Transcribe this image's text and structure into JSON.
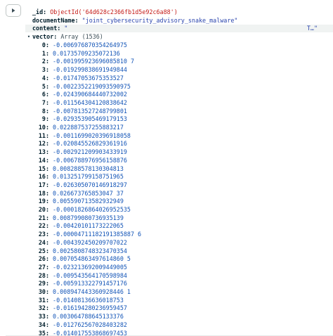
{
  "document": {
    "id_key": "_id:",
    "id_value": "ObjectId('64d628c2366fb1d5e92c6a88')",
    "document_name_key": "documentName:",
    "document_name_value": "\"joint_cybersecurity_advisory_snake_malware\"",
    "content_key": "content:",
    "content_value": "\"",
    "content_tail": "T…\"",
    "vector_key": "vector:",
    "vector_type": "Array (1536)",
    "vector_items": [
      {
        "index": "0:",
        "value": "-0.006976870354264975"
      },
      {
        "index": "1:",
        "value": "0.01735709235072136"
      },
      {
        "index": "2:",
        "value": "-0.001995923696085810 7"
      },
      {
        "index": "3:",
        "value": "-0.019299838691949844"
      },
      {
        "index": "4:",
        "value": "-0.01747053675353527"
      },
      {
        "index": "5:",
        "value": "-0.0022352219093590975"
      },
      {
        "index": "6:",
        "value": "-0.024390684440732002"
      },
      {
        "index": "7:",
        "value": "-0.011564304120838642"
      },
      {
        "index": "8:",
        "value": "-0.007813527248799801"
      },
      {
        "index": "9:",
        "value": "-0.029353905469179153"
      },
      {
        "index": "10:",
        "value": "0.022887537255883217"
      },
      {
        "index": "11:",
        "value": "-0.0011699020396918058"
      },
      {
        "index": "12:",
        "value": "-0.020845526829361916"
      },
      {
        "index": "13:",
        "value": "-0.002921209903433919"
      },
      {
        "index": "14:",
        "value": "-0.006788976956158876"
      },
      {
        "index": "15:",
        "value": "0.008288578130304813"
      },
      {
        "index": "16:",
        "value": "0.013251799158751965"
      },
      {
        "index": "17:",
        "value": "-0.026305070146918297"
      },
      {
        "index": "18:",
        "value": "0.026673765853047 37"
      },
      {
        "index": "19:",
        "value": "0.005590713582932949"
      },
      {
        "index": "20:",
        "value": "-0.0001826864026952535"
      },
      {
        "index": "21:",
        "value": "0.008799080736935139"
      },
      {
        "index": "22:",
        "value": "-0.00420101173222065"
      },
      {
        "index": "23:",
        "value": "-0.00004711182191385887 6"
      },
      {
        "index": "24:",
        "value": "-0.004392450209707022"
      },
      {
        "index": "25:",
        "value": "0.0025808748323470354"
      },
      {
        "index": "26:",
        "value": "0.007054863497614860 5"
      },
      {
        "index": "27:",
        "value": "-0.023213692009449005"
      },
      {
        "index": "28:",
        "value": "-0.009543564170598984"
      },
      {
        "index": "29:",
        "value": "-0.005913322791457176"
      },
      {
        "index": "30:",
        "value": "0.008947443360928446 1"
      },
      {
        "index": "31:",
        "value": "-0.01408136636018753"
      },
      {
        "index": "32:",
        "value": "-0.016194280236959457"
      },
      {
        "index": "33:",
        "value": "0.003064788645133376"
      },
      {
        "index": "34:",
        "value": "-0.012762567028403282"
      },
      {
        "index": "35:",
        "value": "-0.014017553868697453"
      }
    ]
  },
  "icons": {
    "expand": "play-triangle-icon",
    "collapse": "caret-down-icon"
  },
  "colors": {
    "object_id": "#c41a16",
    "string": "#2a44ad",
    "number": "#1254b7",
    "key": "#001e2b"
  }
}
